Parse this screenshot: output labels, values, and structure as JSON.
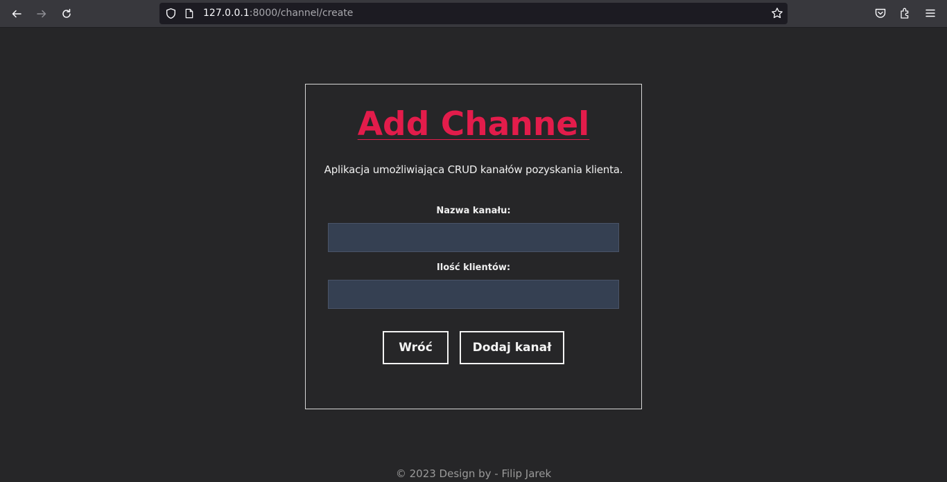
{
  "browser": {
    "url_host": "127.0.0.1",
    "url_rest": ":8000/channel/create"
  },
  "card": {
    "title": "Add Channel",
    "description": "Aplikacja umożliwiająca CRUD kanałów pozyskania klienta.",
    "fields": [
      {
        "label": "Nazwa kanału:",
        "value": ""
      },
      {
        "label": "Ilość klientów:",
        "value": ""
      }
    ],
    "buttons": {
      "back": "Wróć",
      "submit": "Dodaj kanał"
    }
  },
  "footer": {
    "text": "© 2023 Design by - Filip Jarek"
  },
  "colors": {
    "accent": "#e31c4b",
    "input_bg": "#354052",
    "page_bg": "#262628"
  }
}
